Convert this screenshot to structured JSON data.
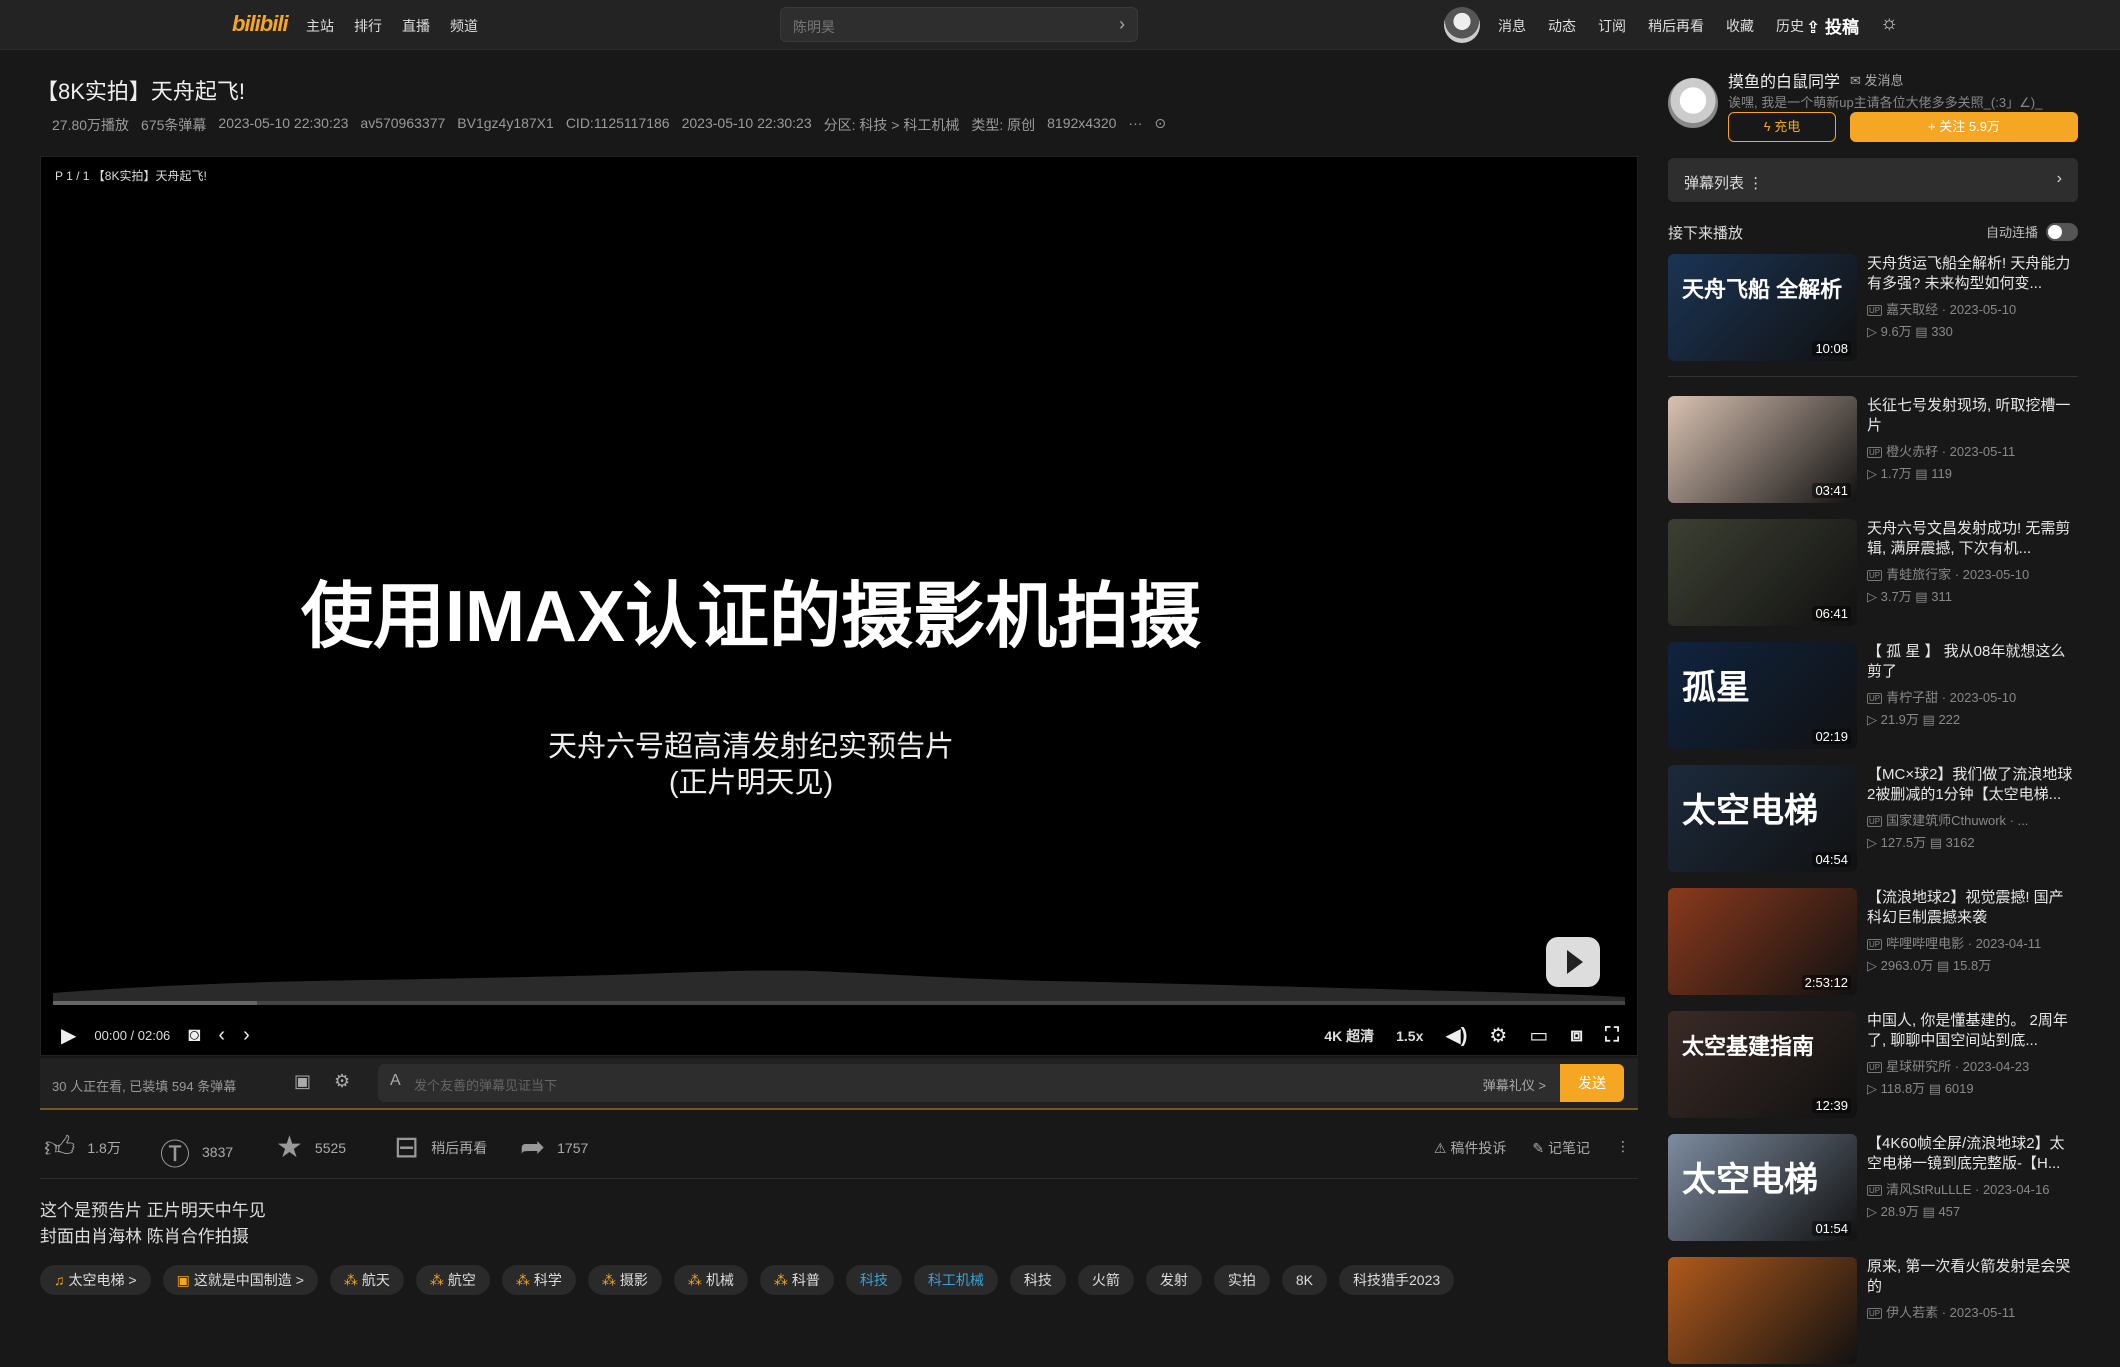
{
  "topbar": {
    "logo": "bilibili",
    "nav": [
      "主站",
      "排行",
      "直播",
      "频道"
    ],
    "search_placeholder": "陈明昊",
    "user_nav": [
      "消息",
      "动态",
      "订阅",
      "稍后再看",
      "收藏",
      "历史"
    ],
    "upload_label": "投稿"
  },
  "video": {
    "title": "【8K实拍】天舟起飞!",
    "meta": [
      "27.80万播放",
      "675条弹幕",
      "2023-05-10 22:30:23",
      "av570963377",
      "BV1gz4y187X1",
      "CID:1125117186",
      "2023-05-10 22:30:23",
      "分区: 科技 > 科工机械",
      "类型: 原创",
      "8192x4320",
      "···"
    ],
    "page_tag": "P 1 / 1 【8K实拍】天舟起飞!",
    "overlay_main": "使用IMAX认证的摄影机拍摄",
    "overlay_sub1": "天舟六号超高清发射纪实预告片",
    "overlay_sub2": "(正片明天见)",
    "progress": 0.13,
    "time": "00:00 / 02:06",
    "quality": "4K 超清",
    "speed": "1.5x"
  },
  "danmaku_bar": {
    "info": "30 人正在看, 已装填 594 条弹幕",
    "placeholder": "发个友善的弹幕见证当下",
    "etiquette": "弹幕礼仪 >",
    "send": "发送"
  },
  "actions": {
    "like": "1.8万",
    "coin": "3837",
    "fav": "5525",
    "later": "稍后再看",
    "share": "1757",
    "report": "稿件投诉",
    "notes": "记笔记"
  },
  "description": [
    "这个是预告片 正片明天中午见",
    "封面由肖海林 陈肖合作拍摄"
  ],
  "tags": [
    {
      "label": "太空电梯 >",
      "icon": "♫",
      "style": "normal"
    },
    {
      "label": "这就是中国制造 >",
      "icon": "▣",
      "style": "normal"
    },
    {
      "label": "航天",
      "icon": "⁂",
      "style": "normal"
    },
    {
      "label": "航空",
      "icon": "⁂",
      "style": "normal"
    },
    {
      "label": "科学",
      "icon": "⁂",
      "style": "normal"
    },
    {
      "label": "摄影",
      "icon": "⁂",
      "style": "normal"
    },
    {
      "label": "机械",
      "icon": "⁂",
      "style": "normal"
    },
    {
      "label": "科普",
      "icon": "⁂",
      "style": "normal"
    },
    {
      "label": "科技",
      "icon": "",
      "style": "blue"
    },
    {
      "label": "科工机械",
      "icon": "",
      "style": "blue"
    },
    {
      "label": "科技",
      "icon": "",
      "style": "normal"
    },
    {
      "label": "火箭",
      "icon": "",
      "style": "normal"
    },
    {
      "label": "发射",
      "icon": "",
      "style": "normal"
    },
    {
      "label": "实拍",
      "icon": "",
      "style": "normal"
    },
    {
      "label": "8K",
      "icon": "",
      "style": "normal"
    },
    {
      "label": "科技猎手2023",
      "icon": "",
      "style": "normal"
    }
  ],
  "uploader": {
    "name": "摸鱼的白鼠同学",
    "message": "发消息",
    "desc": "诶嘿, 我是一个萌新up主请各位大佬多多关照_(:3」∠)_",
    "charge": "充电",
    "follow": "+ 关注 5.9万"
  },
  "sidebar": {
    "danmaku_list": "弹幕列表",
    "next_up": "接下来播放",
    "autoplay": "自动连播"
  },
  "recommendations": [
    {
      "title": "天舟货运飞船全解析! 天舟能力有多强? 未来构型如何变...",
      "up": "嘉天取经 · 2023-05-10",
      "views": "9.6万",
      "danmaku": "330",
      "duration": "10:08",
      "thumb_text": "天舟飞船 全解析",
      "bg": "#1b3455"
    },
    {
      "title": "长征七号发射现场, 听取挖槽一片",
      "up": "橙火赤籽 · 2023-05-11",
      "views": "1.7万",
      "danmaku": "119",
      "duration": "03:41",
      "thumb_text": "",
      "bg": "#d9c2b2"
    },
    {
      "title": "天舟六号文昌发射成功! 无需剪辑, 满屏震撼, 下次有机...",
      "up": "青蛙旅行家 · 2023-05-10",
      "views": "3.7万",
      "danmaku": "311",
      "duration": "06:41",
      "thumb_text": "",
      "bg": "#3c4032"
    },
    {
      "title": "【 孤 星 】 我从08年就想这么剪了",
      "up": "青柠子甜 · 2023-05-10",
      "views": "21.9万",
      "danmaku": "222",
      "duration": "02:19",
      "thumb_text": "孤星",
      "bg": "#10233f"
    },
    {
      "title": "【MC×球2】我们做了流浪地球2被删减的1分钟【太空电梯...",
      "up": "国家建筑师Cthuwork · ...",
      "views": "127.5万",
      "danmaku": "3162",
      "duration": "04:54",
      "thumb_text": "太空电梯",
      "bg": "#1c2a3c"
    },
    {
      "title": "【流浪地球2】视觉震撼! 国产科幻巨制震撼来袭",
      "up": "哔哩哔哩电影 · 2023-04-11",
      "views": "2963.0万",
      "danmaku": "15.8万",
      "duration": "2:53:12",
      "thumb_text": "",
      "bg": "#8a3a1d"
    },
    {
      "title": "中国人, 你是懂基建的。 2周年了, 聊聊中国空间站到底...",
      "up": "星球研究所 · 2023-04-23",
      "views": "118.8万",
      "danmaku": "6019",
      "duration": "12:39",
      "thumb_text": "太空基建指南",
      "bg": "#3a2a25"
    },
    {
      "title": "【4K60帧全屏/流浪地球2】太空电梯一镜到底完整版-【H...",
      "up": "清风StRuLLLE · 2023-04-16",
      "views": "28.9万",
      "danmaku": "457",
      "duration": "01:54",
      "thumb_text": "太空电梯",
      "bg": "#7d8ca0"
    },
    {
      "title": "原来, 第一次看火箭发射是会哭的",
      "up": "伊人若素 · 2023-05-11",
      "views": "",
      "danmaku": "",
      "duration": "",
      "thumb_text": "",
      "bg": "#b05a1c"
    }
  ]
}
